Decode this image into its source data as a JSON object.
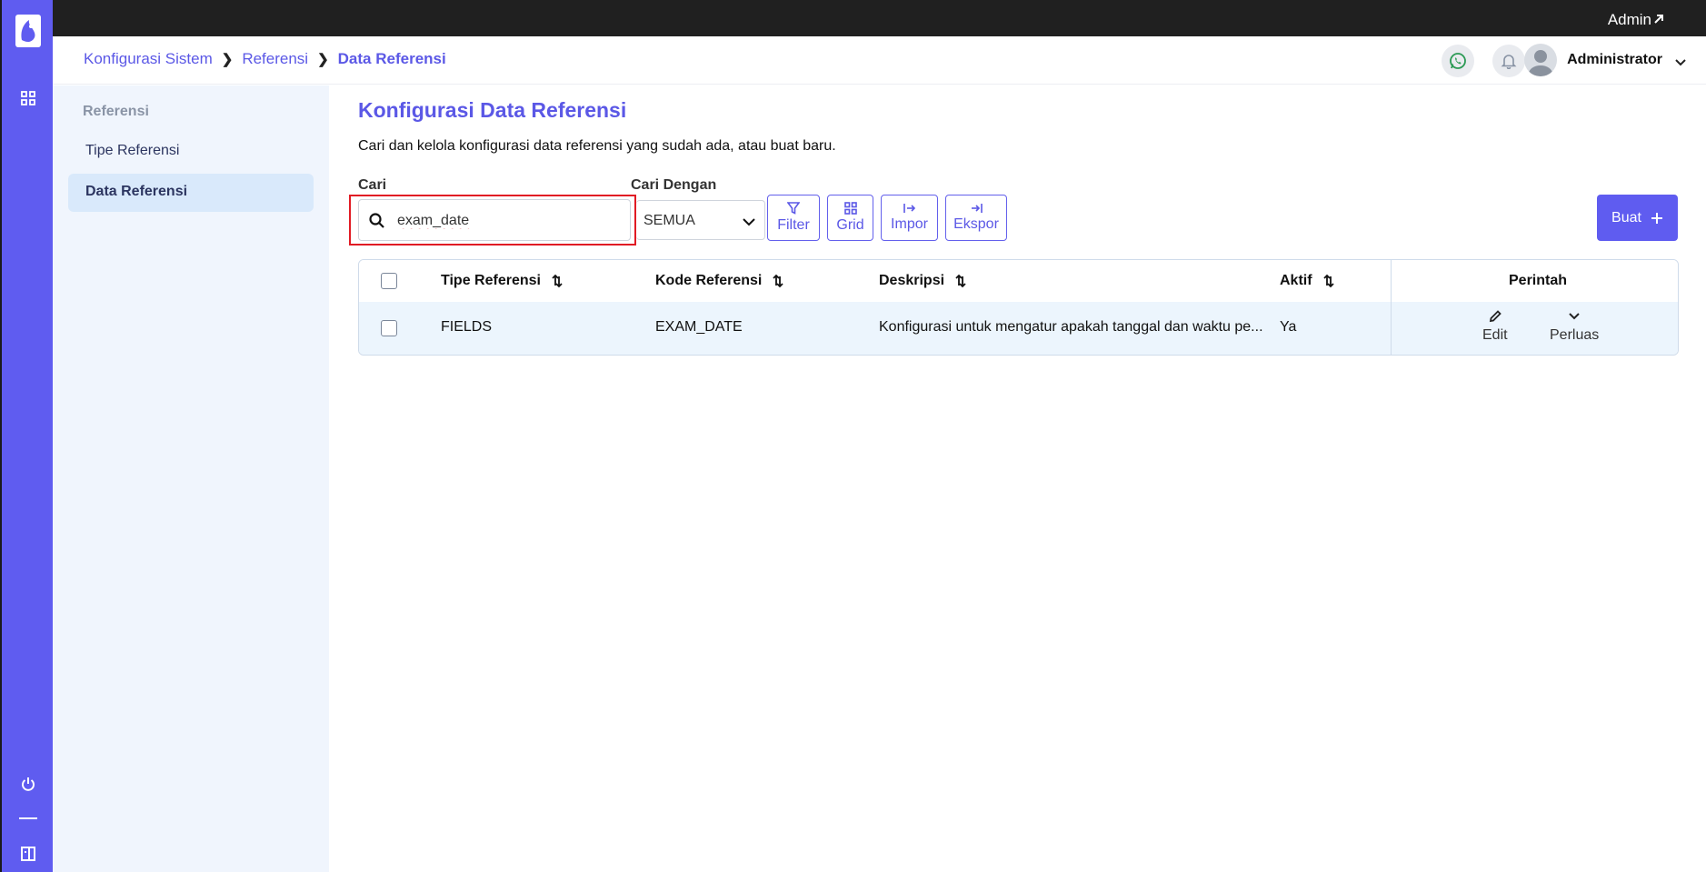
{
  "topbar": {
    "admin_label": "Admin"
  },
  "breadcrumb": {
    "items": [
      "Konfigurasi Sistem",
      "Referensi",
      "Data Referensi"
    ]
  },
  "header": {
    "user_name": "Administrator"
  },
  "sidebar": {
    "section": "Referensi",
    "items": [
      {
        "label": "Tipe Referensi"
      },
      {
        "label": "Data Referensi"
      }
    ]
  },
  "page": {
    "title": "Konfigurasi Data Referensi",
    "description": "Cari dan kelola konfigurasi data referensi yang sudah ada, atau buat baru."
  },
  "search": {
    "label": "Cari",
    "value": "exam_date"
  },
  "search_by": {
    "label": "Cari Dengan",
    "selected": "SEMUA"
  },
  "toolbar": {
    "filter": "Filter",
    "grid": "Grid",
    "import": "Impor",
    "export": "Ekspor",
    "create": "Buat"
  },
  "table": {
    "columns": [
      "Tipe Referensi",
      "Kode Referensi",
      "Deskripsi",
      "Aktif",
      "Perintah"
    ],
    "rows": [
      {
        "tipe": "FIELDS",
        "kode": "EXAM_DATE",
        "deskripsi": "Konfigurasi untuk mengatur apakah tanggal dan waktu pe...",
        "aktif": "Ya"
      }
    ],
    "actions": {
      "edit": "Edit",
      "expand": "Perluas"
    }
  },
  "colors": {
    "accent": "#5f5cf0",
    "topbar": "#202020",
    "sidebar_bg": "#f0f5fd",
    "row_bg": "#ecf5fd",
    "highlight": "#e11b24"
  }
}
